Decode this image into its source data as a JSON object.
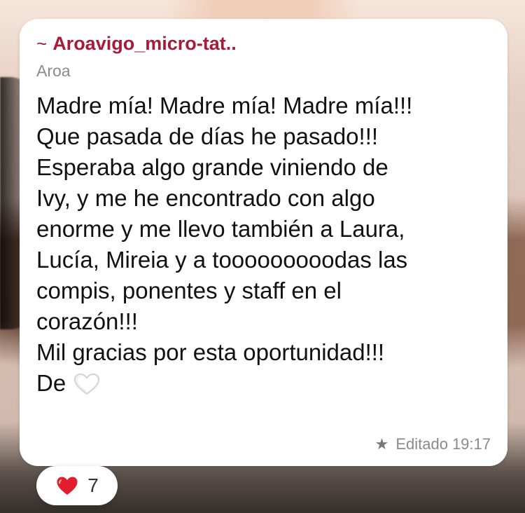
{
  "message": {
    "sender": {
      "tilde": "~",
      "name": "Aroavigo_micro-tat.."
    },
    "subname": "Aroa",
    "lines": [
      "Madre mía! Madre mía! Madre mía!!!",
      "Que pasada de días he pasado!!!",
      "Esperaba algo grande viniendo de",
      "Ivy, y me he encontrado con algo",
      "enorme y me llevo también a Laura,",
      "Lucía, Mireia y a tooooooooodas las",
      "compis, ponentes y staff en el",
      "corazón!!!",
      "Mil gracias por esta oportunidad!!!",
      "De"
    ],
    "emoji_icon": "white-heart-icon",
    "meta": {
      "star_icon": "star-icon",
      "edited_label": "Editado",
      "time": "19:17"
    }
  },
  "reaction": {
    "icon": "red-heart-icon",
    "count": "7"
  },
  "colors": {
    "sender": "#a61b3b",
    "bubble": "#ffffff",
    "meta_text": "#8a8a8a",
    "reaction_heart": "#e11d2e"
  }
}
